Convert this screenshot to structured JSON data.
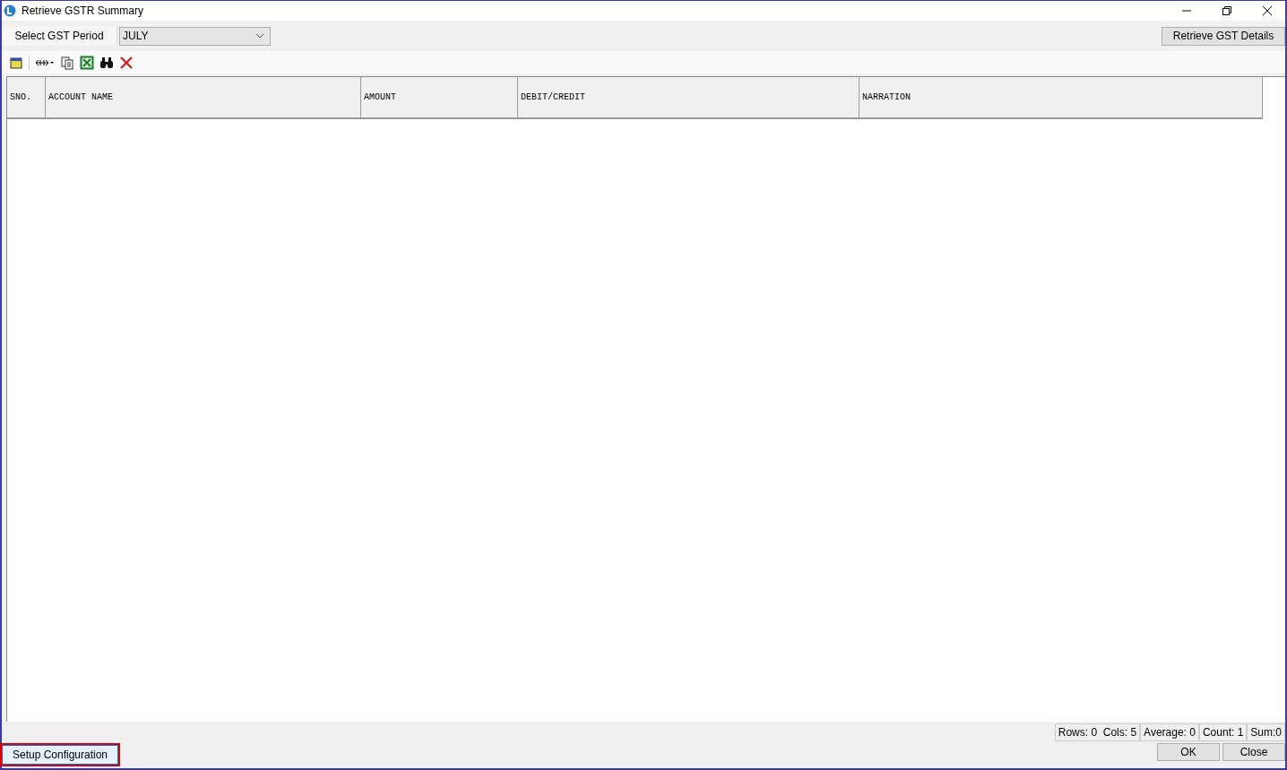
{
  "window": {
    "title": "Retrieve GSTR Summary"
  },
  "period": {
    "label": "Select GST Period",
    "value": "JULY"
  },
  "retrieve_button": "Retrieve GST Details",
  "toolbar": [
    {
      "kind": "window"
    },
    {
      "kind": "separator"
    },
    {
      "kind": "resize"
    },
    {
      "kind": "copy"
    },
    {
      "kind": "excel"
    },
    {
      "kind": "find"
    },
    {
      "kind": "delete"
    }
  ],
  "table": {
    "columns": [
      "SNO.",
      "ACCOUNT NAME",
      "AMOUNT",
      "DEBIT/CREDIT",
      "NARRATION"
    ]
  },
  "status_bar": [
    "Rows: 0  Cols: 5",
    "Average: 0",
    "Count: 1",
    "Sum:0"
  ],
  "buttons": [
    {
      "label": "OK"
    },
    {
      "label": "Close"
    }
  ],
  "setup_button": {
    "label": "Setup Configuration",
    "focused": true
  }
}
